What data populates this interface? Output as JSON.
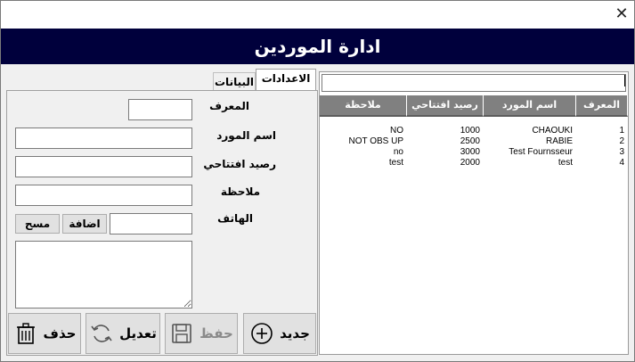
{
  "window": {
    "close_glyph": "✕"
  },
  "header": {
    "title": "ادارة الموردين"
  },
  "tabs": [
    {
      "label": "الاعدادات",
      "active": true
    },
    {
      "label": "البيانات",
      "active": false
    }
  ],
  "form": {
    "id_label": "المعرف",
    "name_label": "اسم المورد",
    "balance_label": "رصيد افتتاحي",
    "note_label": "ملاحظة",
    "phone_label": "الهاتف",
    "id_value": "",
    "name_value": "",
    "balance_value": "",
    "note_value": "",
    "phone_value": "",
    "memo_value": ""
  },
  "phone_buttons": {
    "add": "اضافة",
    "clear": "مسح"
  },
  "actions": {
    "new": "جديد",
    "save": "حفظ",
    "edit": "تعديل",
    "delete": "حذف"
  },
  "grid": {
    "search_value": "",
    "columns": [
      "المعرف",
      "اسم المورد",
      "رصيد افتتاحي",
      "ملاحظة"
    ],
    "rows": [
      [
        "1",
        "CHAOUKI",
        "1000",
        "NO"
      ],
      [
        "2",
        "RABIE",
        "2500",
        "NOT OBS UP"
      ],
      [
        "3",
        "Test Fournsseur",
        "3000",
        "no"
      ],
      [
        "4",
        "test",
        "2000",
        "test"
      ]
    ]
  },
  "icons": {
    "new": "plus-circle-icon",
    "save": "floppy-disk-icon",
    "edit": "refresh-icon",
    "delete": "trash-icon"
  }
}
